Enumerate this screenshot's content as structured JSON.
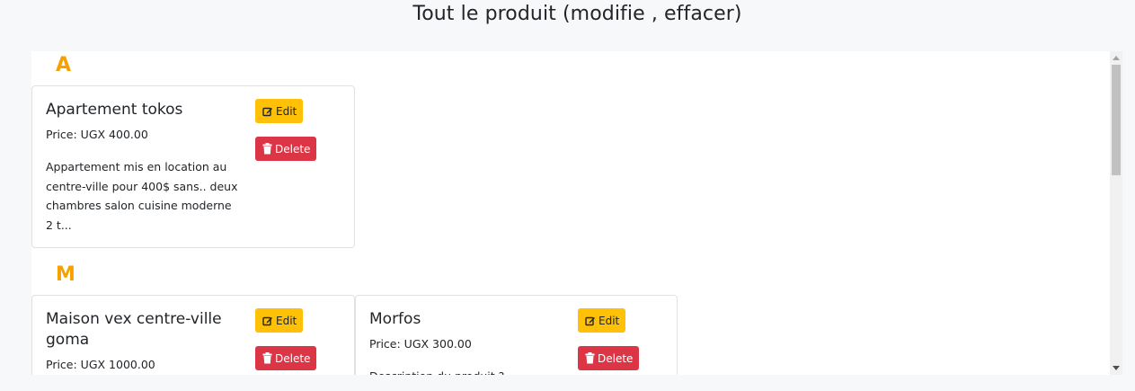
{
  "page": {
    "title": "Tout le produit (modifie , effacer)"
  },
  "sections": [
    {
      "letter": "A",
      "products": [
        {
          "name": "Apartement tokos",
          "price": "Price: UGX 400.00",
          "description_lines": [
            "Appartement mis en location au",
            "centre-ville pour 400$ sans.. deux",
            "chambres salon cuisine moderne",
            "2 t..."
          ],
          "edit_label": "Edit",
          "delete_label": "Delete"
        }
      ]
    },
    {
      "letter": "M",
      "products": [
        {
          "name_lines": [
            "Maison vex centre-ville",
            "goma"
          ],
          "price": "Price: UGX 1000.00",
          "edit_label": "Edit",
          "delete_label": "Delete"
        },
        {
          "name": "Morfos",
          "price": "Price: UGX 300.00",
          "description_partial": "Description du produit ?",
          "edit_label": "Edit",
          "delete_label": "Delete"
        }
      ]
    }
  ],
  "icons": {
    "edit": "pen-to-square-icon",
    "delete": "trash-icon"
  },
  "colors": {
    "letter": "#f5a100",
    "edit_button": "#ffc107",
    "delete_button": "#dc3545"
  }
}
